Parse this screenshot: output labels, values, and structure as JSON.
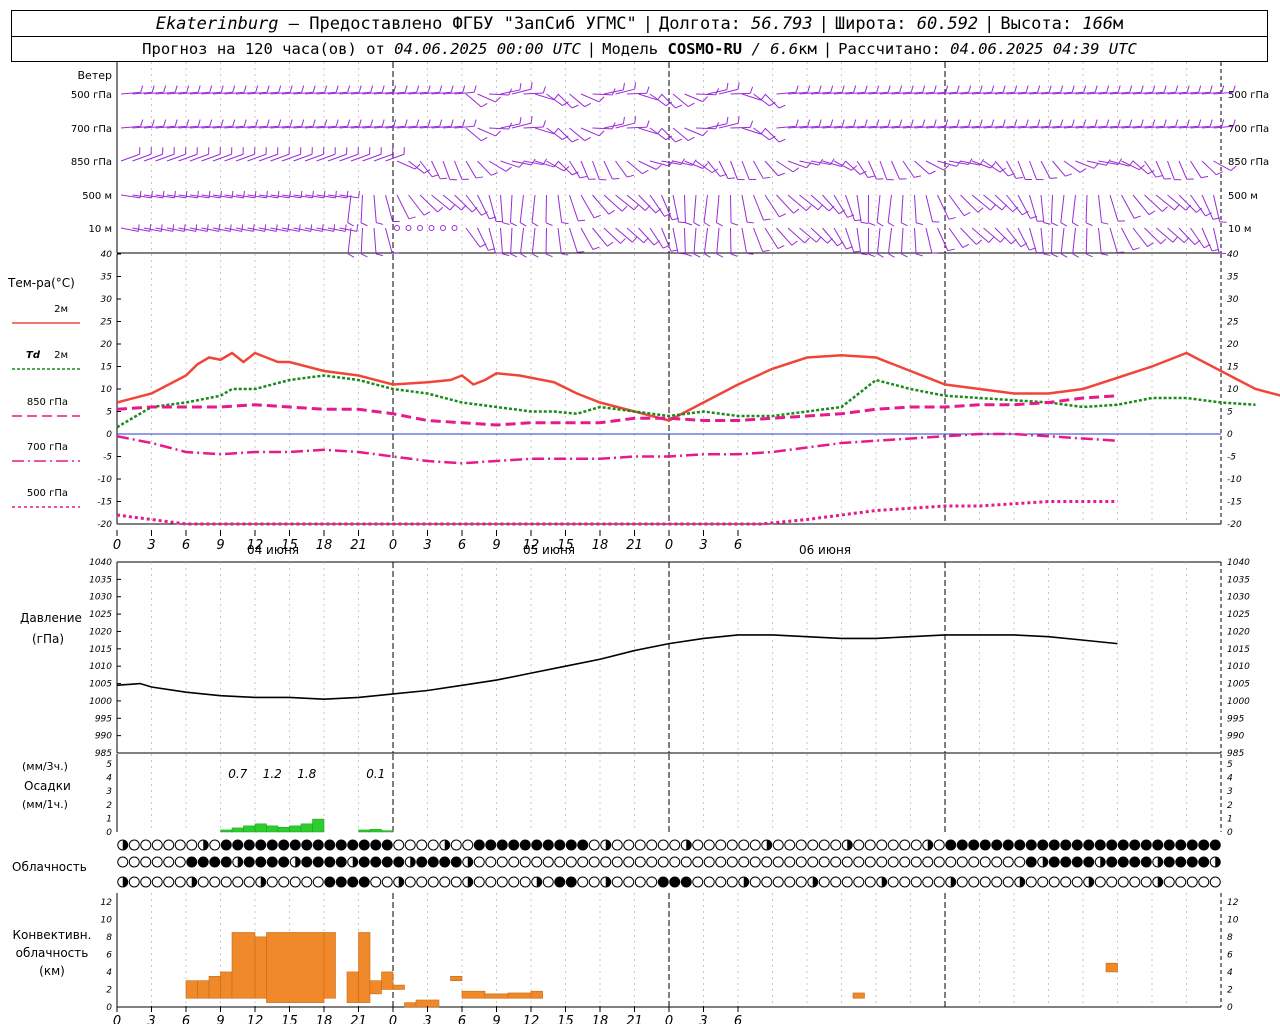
{
  "header": {
    "station": "Ekaterinburg",
    "provider": "– Предоставлено ФГБУ \"ЗапСиб УГМС\"",
    "lon_label": "Долгота:",
    "lon_value": "56.793",
    "lat_label": "Широта:",
    "lat_value": "60.592",
    "alt_label": "Высота:",
    "alt_value": "166",
    "alt_unit": "м",
    "forecast_label": "Прогноз на 120 часа(ов) от",
    "forecast_from": "04.06.2025 00:00 UTC",
    "model_label": "Модель",
    "model_name": "COSMO-RU",
    "model_res": "/ 6.6",
    "model_res_unit": "км",
    "calc_label": "Рассчитано:",
    "calc_time": "04.06.2025 04:39 UTC"
  },
  "colors": {
    "wind": "#9a2bd6",
    "t2m": "#f0463a",
    "td2m": "#1a8a1a",
    "t850": "#e8198a",
    "t700": "#e8198a",
    "t500": "#e8198a",
    "zero_line": "#2a3ad0",
    "pressure": "#000000",
    "precip": "#2ccd2c",
    "convective": "#f0892a"
  },
  "chart_data": [
    {
      "type": "wind_barbs",
      "title": "Ветер",
      "levels": [
        "500 гПа",
        "700 гПа",
        "850 гПа",
        "500 м",
        "10 м"
      ],
      "note": "wind barbs every hour at each level"
    },
    {
      "type": "line",
      "ylabel": "Тем-ра(°C)",
      "ylim": [
        -20,
        40
      ],
      "yticks": [
        -20,
        -15,
        -10,
        -5,
        0,
        5,
        10,
        15,
        20,
        25,
        30,
        35,
        40
      ],
      "x_hours_ticks": [
        "0",
        "3",
        "6",
        "9",
        "12",
        "15",
        "18",
        "21",
        "0",
        "3",
        "6",
        "9",
        "12",
        "15",
        "18",
        "21",
        "0",
        "3",
        "6"
      ],
      "dates": [
        "04 июня",
        "05 июня",
        "06 июня"
      ],
      "legend": [
        {
          "key": "t2m",
          "label": "2м"
        },
        {
          "key": "td2m",
          "label_prefix": "Td",
          "label": "2м"
        },
        {
          "key": "t850",
          "label": "850 гПа"
        },
        {
          "key": "t700",
          "label": "700 гПа"
        },
        {
          "key": "t500",
          "label": "500 гПа"
        }
      ],
      "series": [
        {
          "key": "t2m",
          "x": [
            0,
            3,
            6,
            7,
            8,
            9,
            10,
            11,
            12,
            13,
            14,
            15,
            18,
            21,
            24,
            27,
            29,
            30,
            31,
            32,
            33,
            35,
            38,
            40,
            42,
            45,
            48,
            51,
            54,
            57,
            60,
            63,
            66,
            69,
            72,
            75,
            78,
            81,
            84,
            87,
            90,
            93,
            96,
            99,
            102
          ],
          "values": [
            7,
            9,
            13,
            15.5,
            17,
            16.5,
            18,
            16,
            18,
            17,
            16,
            16,
            14,
            13,
            11,
            11.5,
            12,
            13,
            11,
            12,
            13.5,
            13,
            11.5,
            9,
            7,
            5,
            3,
            7,
            11,
            14.5,
            17,
            17.5,
            17,
            14,
            11,
            10,
            9,
            9,
            10,
            12.5,
            15,
            18,
            14,
            10,
            8
          ]
        },
        {
          "key": "td2m",
          "x": [
            0,
            3,
            6,
            9,
            10,
            12,
            15,
            18,
            21,
            24,
            27,
            30,
            33,
            36,
            38,
            40,
            42,
            45,
            48,
            51,
            54,
            57,
            60,
            63,
            65,
            66,
            69,
            72,
            75,
            78,
            81,
            84,
            87,
            90,
            93,
            96,
            99
          ],
          "values": [
            1.5,
            6,
            7,
            8.5,
            10,
            10,
            12,
            13,
            12,
            10,
            9,
            7,
            6,
            5,
            5,
            4.5,
            6,
            5,
            4,
            5,
            4,
            4,
            5,
            6,
            10,
            12,
            10,
            8.5,
            8,
            7.5,
            7,
            6,
            6.5,
            8,
            8,
            7,
            6.5
          ]
        },
        {
          "key": "t850",
          "x": [
            0,
            3,
            6,
            9,
            12,
            15,
            18,
            21,
            24,
            27,
            30,
            33,
            36,
            39,
            42,
            45,
            48,
            51,
            54,
            57,
            60,
            63,
            66,
            69,
            72,
            75,
            78,
            81,
            84,
            87
          ],
          "values": [
            5.5,
            6,
            6,
            6,
            6.5,
            6,
            5.5,
            5.5,
            4.5,
            3,
            2.5,
            2,
            2.5,
            2.5,
            2.5,
            3.5,
            3.5,
            3,
            3,
            3.5,
            4,
            4.5,
            5.5,
            6,
            6,
            6.5,
            6.5,
            7,
            8,
            8.5
          ]
        },
        {
          "key": "t700",
          "x": [
            0,
            3,
            6,
            9,
            12,
            15,
            18,
            21,
            24,
            27,
            30,
            33,
            36,
            39,
            42,
            45,
            48,
            51,
            54,
            57,
            60,
            63,
            66,
            69,
            72,
            75,
            78,
            81,
            84,
            87
          ],
          "values": [
            -0.5,
            -2,
            -4,
            -4.5,
            -4,
            -4,
            -3.5,
            -4,
            -5,
            -6,
            -6.5,
            -6,
            -5.5,
            -5.5,
            -5.5,
            -5,
            -5,
            -4.5,
            -4.5,
            -4,
            -3,
            -2,
            -1.5,
            -1,
            -0.5,
            0,
            0,
            -0.5,
            -1,
            -1.5
          ]
        },
        {
          "key": "t500",
          "x": [
            0,
            3,
            6,
            56,
            60,
            63,
            66,
            69,
            72,
            75,
            78,
            81,
            84,
            87
          ],
          "values": [
            -18,
            -19,
            -20,
            -20,
            -19,
            -18,
            -17,
            -16.5,
            -16,
            -16,
            -15.5,
            -15,
            -15,
            -15
          ]
        }
      ]
    },
    {
      "type": "line",
      "ylabel": "Давление",
      "yunit": "(гПа)",
      "ylim": [
        985,
        1040
      ],
      "yticks": [
        985,
        990,
        995,
        1000,
        1005,
        1010,
        1015,
        1020,
        1025,
        1030,
        1035,
        1040
      ],
      "series": [
        {
          "key": "pressure",
          "x": [
            0,
            2,
            3,
            6,
            9,
            12,
            15,
            18,
            21,
            24,
            27,
            30,
            33,
            36,
            39,
            42,
            45,
            48,
            51,
            54,
            57,
            60,
            63,
            66,
            69,
            72,
            75,
            78,
            81,
            84,
            87
          ],
          "values": [
            1004.5,
            1005,
            1004,
            1002.5,
            1001.5,
            1001,
            1001,
            1000.5,
            1001,
            1002,
            1003,
            1004.5,
            1006,
            1008,
            1010,
            1012,
            1014.5,
            1016.5,
            1018,
            1019,
            1019,
            1018.5,
            1018,
            1018,
            1018.5,
            1019,
            1019,
            1019,
            1018.5,
            1017.5,
            1016.5
          ]
        }
      ]
    },
    {
      "type": "bar",
      "ylabel": "Осадки",
      "yunit_top": "(мм/3ч.)",
      "yunit_bottom": "(мм/1ч.)",
      "ylim": [
        0,
        5
      ],
      "yticks": [
        0,
        1,
        2,
        3,
        4,
        5
      ],
      "x": [
        9,
        10,
        11,
        12,
        13,
        14,
        15,
        16,
        17,
        21,
        22,
        23
      ],
      "values": [
        0.15,
        0.3,
        0.45,
        0.6,
        0.45,
        0.35,
        0.45,
        0.6,
        0.95,
        0.15,
        0.2,
        0.1
      ],
      "annotations": [
        {
          "x": 10.5,
          "text": "0.7"
        },
        {
          "x": 13.5,
          "text": "1.2"
        },
        {
          "x": 16.5,
          "text": "1.8"
        },
        {
          "x": 22.5,
          "text": "0.1"
        }
      ]
    },
    {
      "type": "cloud_symbols",
      "ylabel": "Облачность",
      "rows": 3,
      "note": "cloud cover fraction per hour: 0 empty circle, 1 filled circle"
    },
    {
      "type": "bar",
      "ylabel_lines": [
        "Конвективн.",
        "облачность",
        "(км)"
      ],
      "ylim": [
        0,
        13
      ],
      "yticks": [
        0,
        2,
        4,
        6,
        8,
        10,
        12
      ],
      "bars": [
        {
          "x": 6,
          "w": 1,
          "bottom": 1,
          "top": 3
        },
        {
          "x": 7,
          "w": 1,
          "bottom": 1,
          "top": 3
        },
        {
          "x": 8,
          "w": 1,
          "bottom": 1,
          "top": 3.5
        },
        {
          "x": 9,
          "w": 1,
          "bottom": 1,
          "top": 4
        },
        {
          "x": 10,
          "w": 2,
          "bottom": 1,
          "top": 8.5
        },
        {
          "x": 12,
          "w": 1,
          "bottom": 1,
          "top": 8
        },
        {
          "x": 13,
          "w": 5,
          "bottom": 0.5,
          "top": 8.5
        },
        {
          "x": 18,
          "w": 1,
          "bottom": 1,
          "top": 8.5
        },
        {
          "x": 20,
          "w": 1,
          "bottom": 0.5,
          "top": 4
        },
        {
          "x": 21,
          "w": 1,
          "bottom": 0.5,
          "top": 8.5
        },
        {
          "x": 22,
          "w": 1,
          "bottom": 1.5,
          "top": 3
        },
        {
          "x": 23,
          "w": 1,
          "bottom": 2,
          "top": 4
        },
        {
          "x": 24,
          "w": 1,
          "bottom": 2,
          "top": 2.5
        },
        {
          "x": 25,
          "w": 1,
          "bottom": 0,
          "top": 0.5
        },
        {
          "x": 26,
          "w": 2,
          "bottom": 0,
          "top": 0.8
        },
        {
          "x": 29,
          "w": 1,
          "bottom": 3,
          "top": 3.5
        },
        {
          "x": 30,
          "w": 2,
          "bottom": 1,
          "top": 1.8
        },
        {
          "x": 32,
          "w": 2,
          "bottom": 1,
          "top": 1.5
        },
        {
          "x": 34,
          "w": 3,
          "bottom": 1,
          "top": 1.6
        },
        {
          "x": 36,
          "w": 1,
          "bottom": 1,
          "top": 1.8
        },
        {
          "x": 64,
          "w": 1,
          "bottom": 1,
          "top": 1.6
        },
        {
          "x": 86,
          "w": 1,
          "bottom": 4,
          "top": 5
        }
      ]
    }
  ]
}
